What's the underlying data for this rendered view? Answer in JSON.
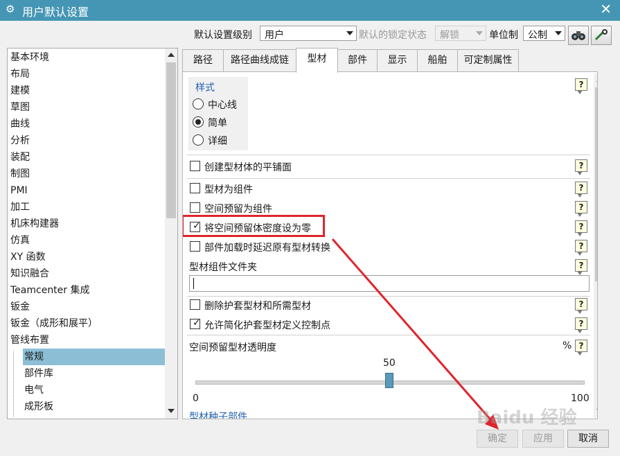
{
  "window": {
    "title": "用户默认设置"
  },
  "toolbar": {
    "level_label": "默认设置级别",
    "level_value": "用户",
    "lock_label": "默认的锁定状态",
    "lock_value": "解锁",
    "unit_label": "单位制",
    "unit_value": "公制"
  },
  "tree": {
    "items": [
      "基本环境",
      "布局",
      "建模",
      "草图",
      "曲线",
      "分析",
      "装配",
      "制图",
      "PMI",
      "加工",
      "机床构建器",
      "仿真",
      "XY 函数",
      "知识融合",
      "Teamcenter 集成",
      "钣金",
      "钣金（成形和展平）",
      "管线布置"
    ],
    "subitems": [
      "常规",
      "部件库",
      "电气",
      "成形板"
    ]
  },
  "tabs": [
    "路径",
    "路径曲线成链",
    "型材",
    "部件",
    "显示",
    "船舶",
    "可定制属性"
  ],
  "style_group": {
    "title": "样式",
    "options": [
      "中心线",
      "简单",
      "详细"
    ]
  },
  "options": {
    "create_planar": "创建型材体的平铺面",
    "as_component": "型材为组件",
    "space_reserve_component": "空间预留为组件",
    "zero_density": "将空间预留体密度设为零",
    "delay_convert": "部件加载时延迟原有型材转换",
    "folder_label": "型材组件文件夹",
    "folder_value": "",
    "delete_protect": "删除护套型材和所需型材",
    "allow_simplify": "允许简化护套型材定义控制点"
  },
  "transparency": {
    "label": "空间预留型材透明度",
    "unit": "%",
    "value": "50",
    "min": "0",
    "max": "100",
    "fraction": 0.5
  },
  "cut_label": "型材种子部件",
  "buttons": {
    "ok": "确定",
    "apply": "应用",
    "cancel": "取消"
  },
  "watermark": "Baidu 经验",
  "colors": {
    "titlebar": "#4596b4",
    "selection": "#8cbfd6",
    "highlight": "#e0242c"
  }
}
